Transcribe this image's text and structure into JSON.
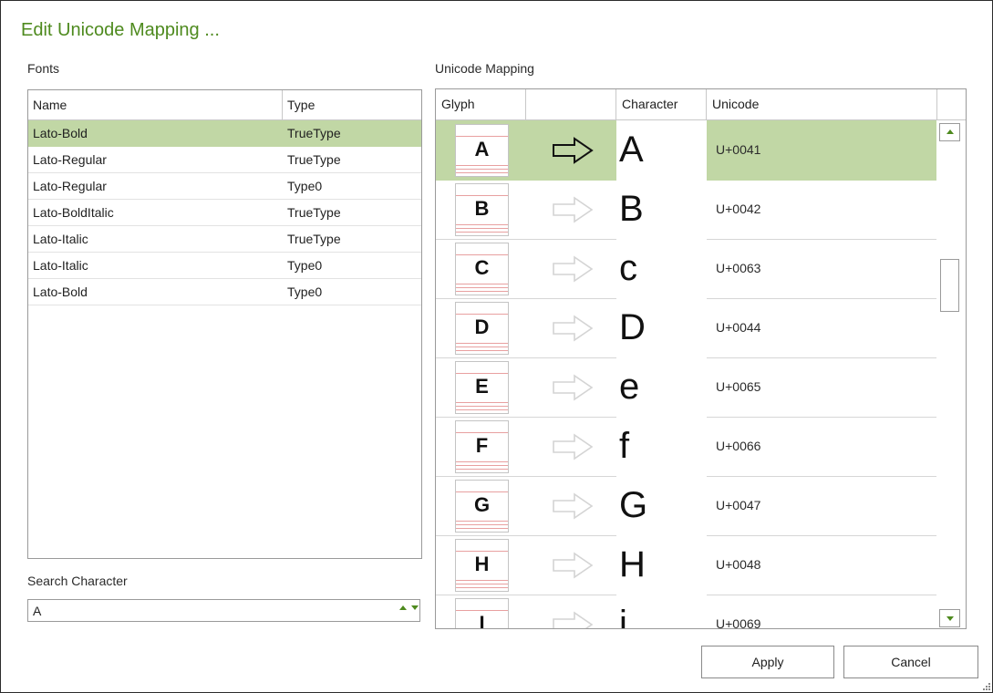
{
  "dialog": {
    "title": "Edit Unicode Mapping ..."
  },
  "fonts": {
    "label": "Fonts",
    "columns": {
      "name": "Name",
      "type": "Type"
    },
    "rows": [
      {
        "name": "Lato-Bold",
        "type": "TrueType",
        "selected": true
      },
      {
        "name": "Lato-Regular",
        "type": "TrueType"
      },
      {
        "name": "Lato-Regular",
        "type": "Type0"
      },
      {
        "name": "Lato-BoldItalic",
        "type": "TrueType"
      },
      {
        "name": "Lato-Italic",
        "type": "TrueType"
      },
      {
        "name": "Lato-Italic",
        "type": "Type0"
      },
      {
        "name": "Lato-Bold",
        "type": "Type0"
      }
    ]
  },
  "search": {
    "label": "Search Character",
    "value": "A"
  },
  "mapping": {
    "label": "Unicode Mapping",
    "columns": {
      "glyph": "Glyph",
      "arrow": "",
      "character": "Character",
      "unicode": "Unicode"
    },
    "rows": [
      {
        "glyph": "A",
        "character": "A",
        "unicode": "U+0041",
        "selected": true
      },
      {
        "glyph": "B",
        "character": "B",
        "unicode": "U+0042"
      },
      {
        "glyph": "C",
        "character": "c",
        "unicode": "U+0063"
      },
      {
        "glyph": "D",
        "character": "D",
        "unicode": "U+0044"
      },
      {
        "glyph": "E",
        "character": "e",
        "unicode": "U+0065"
      },
      {
        "glyph": "F",
        "character": "f",
        "unicode": "U+0066"
      },
      {
        "glyph": "G",
        "character": "G",
        "unicode": "U+0047"
      },
      {
        "glyph": "H",
        "character": "H",
        "unicode": "U+0048"
      },
      {
        "glyph": "I",
        "character": "i",
        "unicode": "U+0069"
      }
    ]
  },
  "buttons": {
    "apply": "Apply",
    "cancel": "Cancel"
  },
  "colors": {
    "accent": "#4e8a1e",
    "selection": "#c1d7a5",
    "border": "#9a9a9a"
  },
  "icons": {
    "arrow": "arrow-right-icon",
    "scroll_up": "chevron-up-icon",
    "scroll_down": "chevron-down-icon"
  }
}
